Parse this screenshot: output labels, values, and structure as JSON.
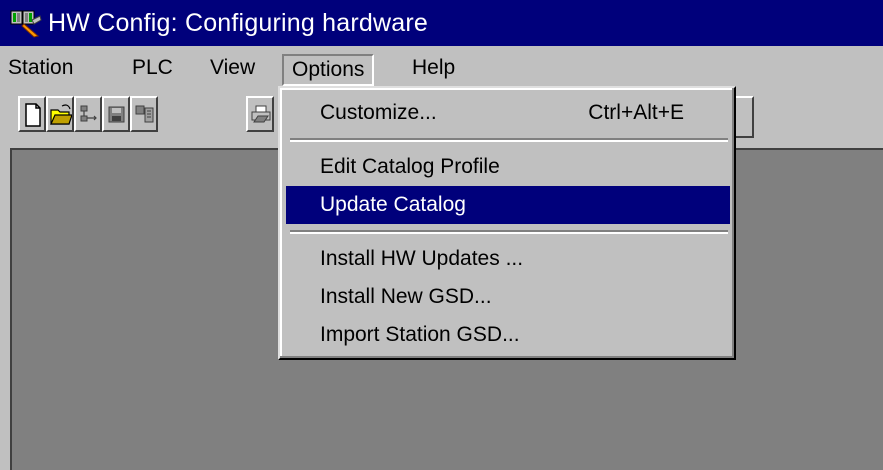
{
  "window": {
    "title": "HW Config: Configuring hardware",
    "title_bar_color": "#00007b",
    "app_icon": "hw-config-app-icon"
  },
  "menubar": {
    "items": [
      {
        "label": "Station"
      },
      {
        "label": "PLC"
      },
      {
        "label": "View"
      },
      {
        "label": "Options",
        "open": true
      },
      {
        "label": "Help"
      }
    ]
  },
  "toolbar": {
    "buttons": [
      {
        "icon": "new-document-icon"
      },
      {
        "icon": "open-folder-icon"
      },
      {
        "icon": "network-icon"
      },
      {
        "icon": "save-icon"
      },
      {
        "icon": "compile-icon"
      },
      {
        "icon": "print-icon"
      }
    ]
  },
  "options_menu": {
    "items": [
      {
        "label": "Customize...",
        "shortcut": "Ctrl+Alt+E",
        "selected": false
      },
      {
        "label": "Edit Catalog Profile",
        "selected": false
      },
      {
        "label": "Update Catalog",
        "selected": true
      },
      {
        "label": "Install HW Updates ...",
        "selected": false
      },
      {
        "label": "Install New GSD...",
        "selected": false
      },
      {
        "label": "Import Station GSD...",
        "selected": false
      }
    ],
    "highlight_color": "#00007b"
  }
}
